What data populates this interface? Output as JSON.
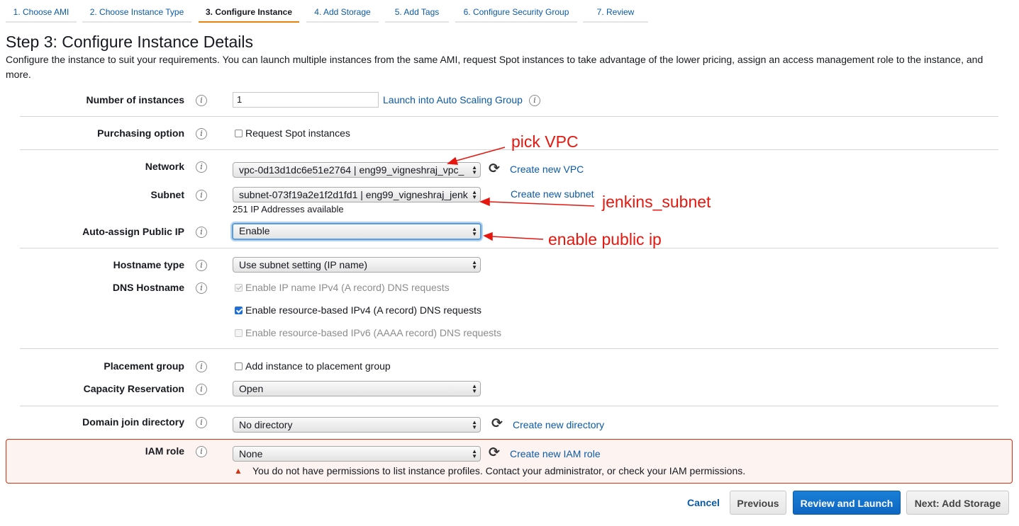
{
  "tabs": [
    {
      "label": "1. Choose AMI"
    },
    {
      "label": "2. Choose Instance Type"
    },
    {
      "label": "3. Configure Instance"
    },
    {
      "label": "4. Add Storage"
    },
    {
      "label": "5. Add Tags"
    },
    {
      "label": "6. Configure Security Group"
    },
    {
      "label": "7. Review"
    }
  ],
  "header": {
    "title": "Step 3: Configure Instance Details",
    "description": "Configure the instance to suit your requirements. You can launch multiple instances from the same AMI, request Spot instances to take advantage of the lower pricing, assign an access management role to the instance, and more."
  },
  "form": {
    "number_of_instances": {
      "label": "Number of instances",
      "value": "1",
      "link": "Launch into Auto Scaling Group"
    },
    "purchasing_option": {
      "label": "Purchasing option",
      "checkbox": "Request Spot instances"
    },
    "network": {
      "label": "Network",
      "value": "vpc-0d13d1dc6e51e2764 | eng99_vigneshraj_vpc_",
      "link": "Create new VPC"
    },
    "subnet": {
      "label": "Subnet",
      "value": "subnet-073f19a2e1f2d1fd1 | eng99_vigneshraj_jenk",
      "link": "Create new subnet",
      "available": "251 IP Addresses available"
    },
    "auto_assign_ip": {
      "label": "Auto-assign Public IP",
      "value": "Enable"
    },
    "hostname_type": {
      "label": "Hostname type",
      "value": "Use subnet setting (IP name)"
    },
    "dns_hostname": {
      "label": "DNS Hostname",
      "option1": "Enable IP name IPv4 (A record) DNS requests",
      "option2": "Enable resource-based IPv4 (A record) DNS requests",
      "option3": "Enable resource-based IPv6 (AAAA record) DNS requests"
    },
    "placement_group": {
      "label": "Placement group",
      "checkbox": "Add instance to placement group"
    },
    "capacity_reservation": {
      "label": "Capacity Reservation",
      "value": "Open"
    },
    "domain_join": {
      "label": "Domain join directory",
      "value": "No directory",
      "link": "Create new directory"
    },
    "iam_role": {
      "label": "IAM role",
      "value": "None",
      "link": "Create new IAM role",
      "warning": "You do not have permissions to list instance profiles. Contact your administrator, or check your IAM permissions."
    }
  },
  "icons": {
    "info": "i",
    "refresh": "⟳",
    "warning": "▲",
    "caret": "▲▼"
  },
  "annotations": {
    "vpc": "pick VPC",
    "subnet": "jenkins_subnet",
    "public_ip": "enable public ip",
    "color": "#e5170f"
  },
  "footer": {
    "cancel": "Cancel",
    "previous": "Previous",
    "review_launch": "Review and Launch",
    "next": "Next: Add Storage"
  }
}
